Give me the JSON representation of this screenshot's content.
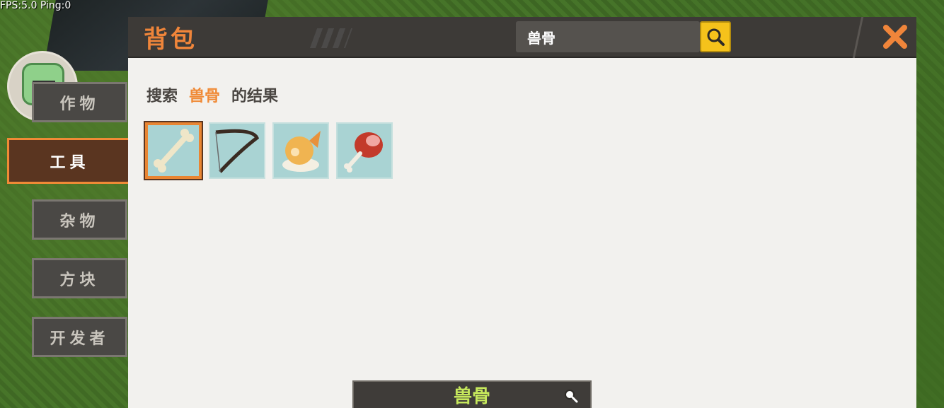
{
  "status": {
    "fps_text": "FPS:5.0  Ping:0"
  },
  "panel": {
    "title": "背包",
    "search": {
      "value": "兽骨",
      "placeholder": ""
    }
  },
  "tabs": [
    {
      "label": "作物",
      "active": false
    },
    {
      "label": "工具",
      "active": true
    },
    {
      "label": "杂物",
      "active": false
    },
    {
      "label": "方块",
      "active": false
    },
    {
      "label": "开发者",
      "active": false
    }
  ],
  "results": {
    "prefix": "搜索",
    "keyword": "兽骨",
    "suffix": "的结果",
    "items": [
      {
        "icon": "bone-icon",
        "selected": true
      },
      {
        "icon": "bow-icon",
        "selected": false
      },
      {
        "icon": "fox-food-icon",
        "selected": false
      },
      {
        "icon": "meat-leg-icon",
        "selected": false
      }
    ]
  },
  "bottom": {
    "label": "兽骨",
    "icon": "magnifier-icon"
  },
  "colors": {
    "accent": "#f08a36",
    "search_button": "#f5c21b",
    "panel_bg": "#f2f1ee",
    "header_bg": "#3d3a37"
  }
}
